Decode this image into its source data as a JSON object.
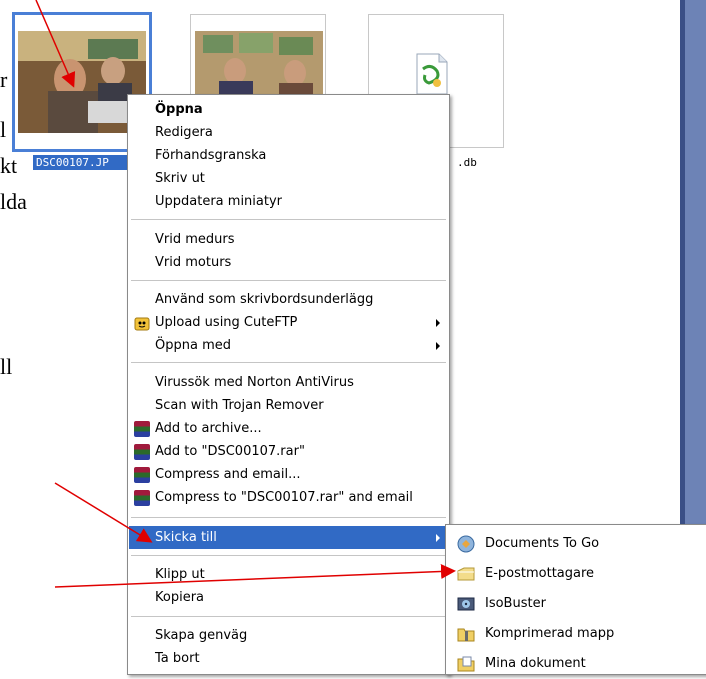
{
  "background": {
    "text_lines": [
      "r",
      "l",
      "kt",
      "lda",
      "ll"
    ],
    "files": [
      {
        "name": "DSC00107.JPG",
        "visible_name": "DSC00107.JP",
        "selected": true
      },
      {
        "name": "",
        "selected": false
      },
      {
        "name": ".db",
        "selected": false
      }
    ]
  },
  "context_menu": {
    "items": [
      {
        "label": "Öppna",
        "bold": true
      },
      {
        "label": "Redigera"
      },
      {
        "label": "Förhandsgranska"
      },
      {
        "label": "Skriv ut"
      },
      {
        "label": "Uppdatera miniatyr"
      },
      {
        "label": "Vrid medurs"
      },
      {
        "label": "Vrid moturs"
      },
      {
        "label": "Använd som skrivbordsunderlägg"
      },
      {
        "label": "Upload using CuteFTP",
        "icon": "cuteftp-icon",
        "submenu": true
      },
      {
        "label": "Öppna med",
        "submenu": true
      },
      {
        "label": "Virussök med Norton AntiVirus"
      },
      {
        "label": "Scan with Trojan Remover"
      },
      {
        "label": "Add to archive...",
        "icon": "winrar-icon"
      },
      {
        "label": "Add to \"DSC00107.rar\"",
        "icon": "winrar-icon"
      },
      {
        "label": "Compress and email...",
        "icon": "winrar-icon"
      },
      {
        "label": "Compress to \"DSC00107.rar\" and email",
        "icon": "winrar-icon"
      },
      {
        "label": "Skicka till",
        "highlighted": true,
        "submenu": true
      },
      {
        "label": "Klipp ut"
      },
      {
        "label": "Kopiera"
      },
      {
        "label": "Skapa genväg"
      },
      {
        "label": "Ta bort"
      }
    ]
  },
  "send_to_submenu": {
    "items": [
      {
        "label": "Documents To Go",
        "icon": "documents-to-go-icon"
      },
      {
        "label": "E-postmottagare",
        "icon": "mail-recipient-icon"
      },
      {
        "label": "IsoBuster",
        "icon": "isobuster-icon"
      },
      {
        "label": "Komprimerad mapp",
        "icon": "zip-folder-icon"
      },
      {
        "label": "Mina dokument",
        "icon": "my-documents-icon"
      }
    ]
  },
  "colors": {
    "highlight": "#316ac5",
    "annotation_arrow": "#e00000",
    "side_bar": "#6d83b6"
  }
}
